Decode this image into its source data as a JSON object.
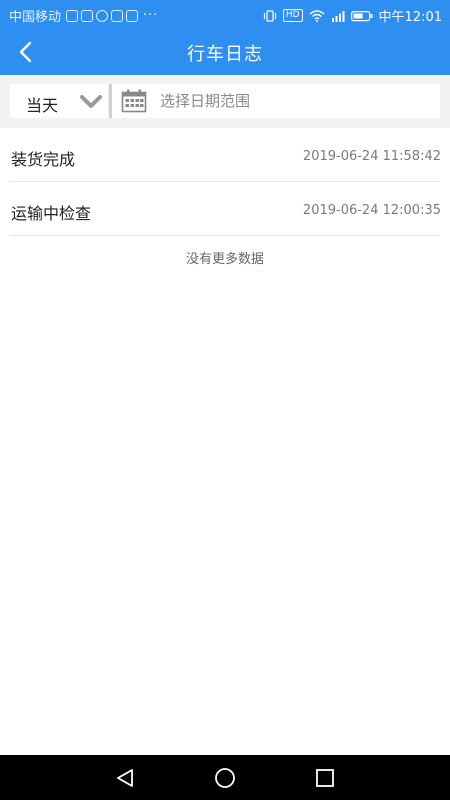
{
  "status_bar": {
    "carrier": "中国移动",
    "more": "···",
    "network": "HD",
    "time": "中午12:01",
    "app_icons": [
      "notification-icon",
      "image-icon",
      "chat-icon",
      "paw-icon",
      "gallery-icon"
    ]
  },
  "header": {
    "title": "行车日志",
    "back_icon": "chevron-left-icon"
  },
  "filter": {
    "period_label": "当天",
    "date_placeholder": "选择日期范围"
  },
  "logs": [
    {
      "title": "装货完成",
      "time": "2019-06-24 11:58:42"
    },
    {
      "title": "运输中检查",
      "time": "2019-06-24 12:00:35"
    }
  ],
  "no_more_text": "没有更多数据",
  "colors": {
    "primary": "#2f8ff0",
    "filter_bg": "#f2f2f2",
    "nav_bg": "#000000"
  }
}
